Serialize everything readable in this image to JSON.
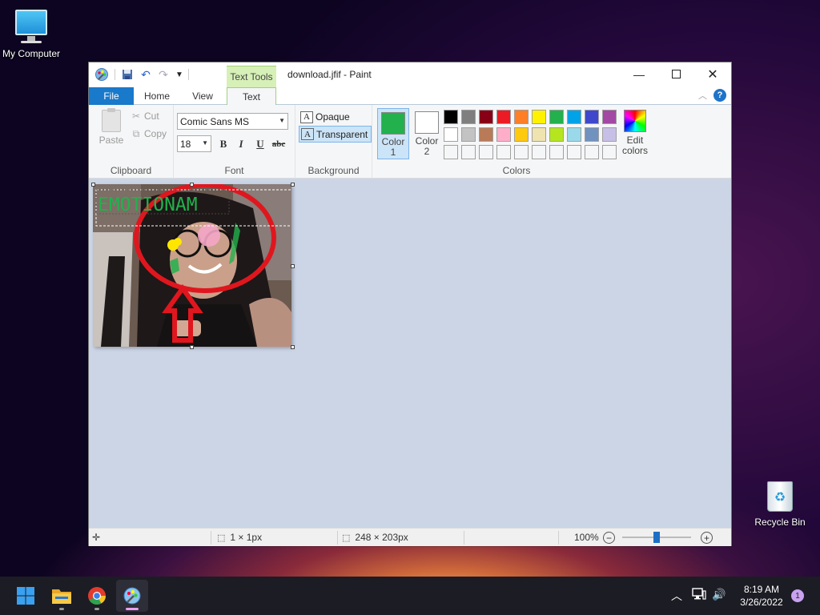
{
  "desktop": {
    "icons": [
      {
        "label": "My Computer"
      },
      {
        "label": "Recycle Bin"
      }
    ]
  },
  "window": {
    "title": "download.jfif - Paint",
    "context_tab": "Text Tools",
    "tabs": [
      "File",
      "Home",
      "View",
      "Text"
    ],
    "active_tab": "Text"
  },
  "ribbon": {
    "clipboard": {
      "label": "Clipboard",
      "paste": "Paste",
      "cut": "Cut",
      "copy": "Copy"
    },
    "font": {
      "label": "Font",
      "family": "Comic Sans MS",
      "size": "18",
      "bold": "B",
      "italic": "I",
      "underline": "U",
      "strike": "abc"
    },
    "background": {
      "label": "Background",
      "opaque": "Opaque",
      "transparent": "Transparent",
      "selected": "Transparent"
    },
    "colors": {
      "label": "Colors",
      "color1_label_a": "Color",
      "color1_label_b": "1",
      "color2_label_a": "Color",
      "color2_label_b": "2",
      "color1": "#22b14c",
      "color2": "#ffffff",
      "edit_label_a": "Edit",
      "edit_label_b": "colors",
      "palette_row1": [
        "#000000",
        "#7f7f7f",
        "#880015",
        "#ed1c24",
        "#ff7f27",
        "#fff200",
        "#22b14c",
        "#00a2e8",
        "#3f48cc",
        "#a349a4"
      ],
      "palette_row2": [
        "#ffffff",
        "#c3c3c3",
        "#b97a57",
        "#ffaec9",
        "#ffc90e",
        "#efe4b0",
        "#b5e61d",
        "#99d9ea",
        "#7092be",
        "#c8bfe7"
      ]
    }
  },
  "canvas": {
    "text_entry": "EMOTIONAM",
    "text_color": "#22b14c",
    "annotation_color": "#e0161e"
  },
  "status": {
    "selection_size": "1 × 1px",
    "image_size": "248 × 203px",
    "zoom": "100%",
    "zoom_percent": 100
  },
  "taskbar": {
    "time": "8:19 AM",
    "date": "3/26/2022",
    "notifications": "1"
  }
}
